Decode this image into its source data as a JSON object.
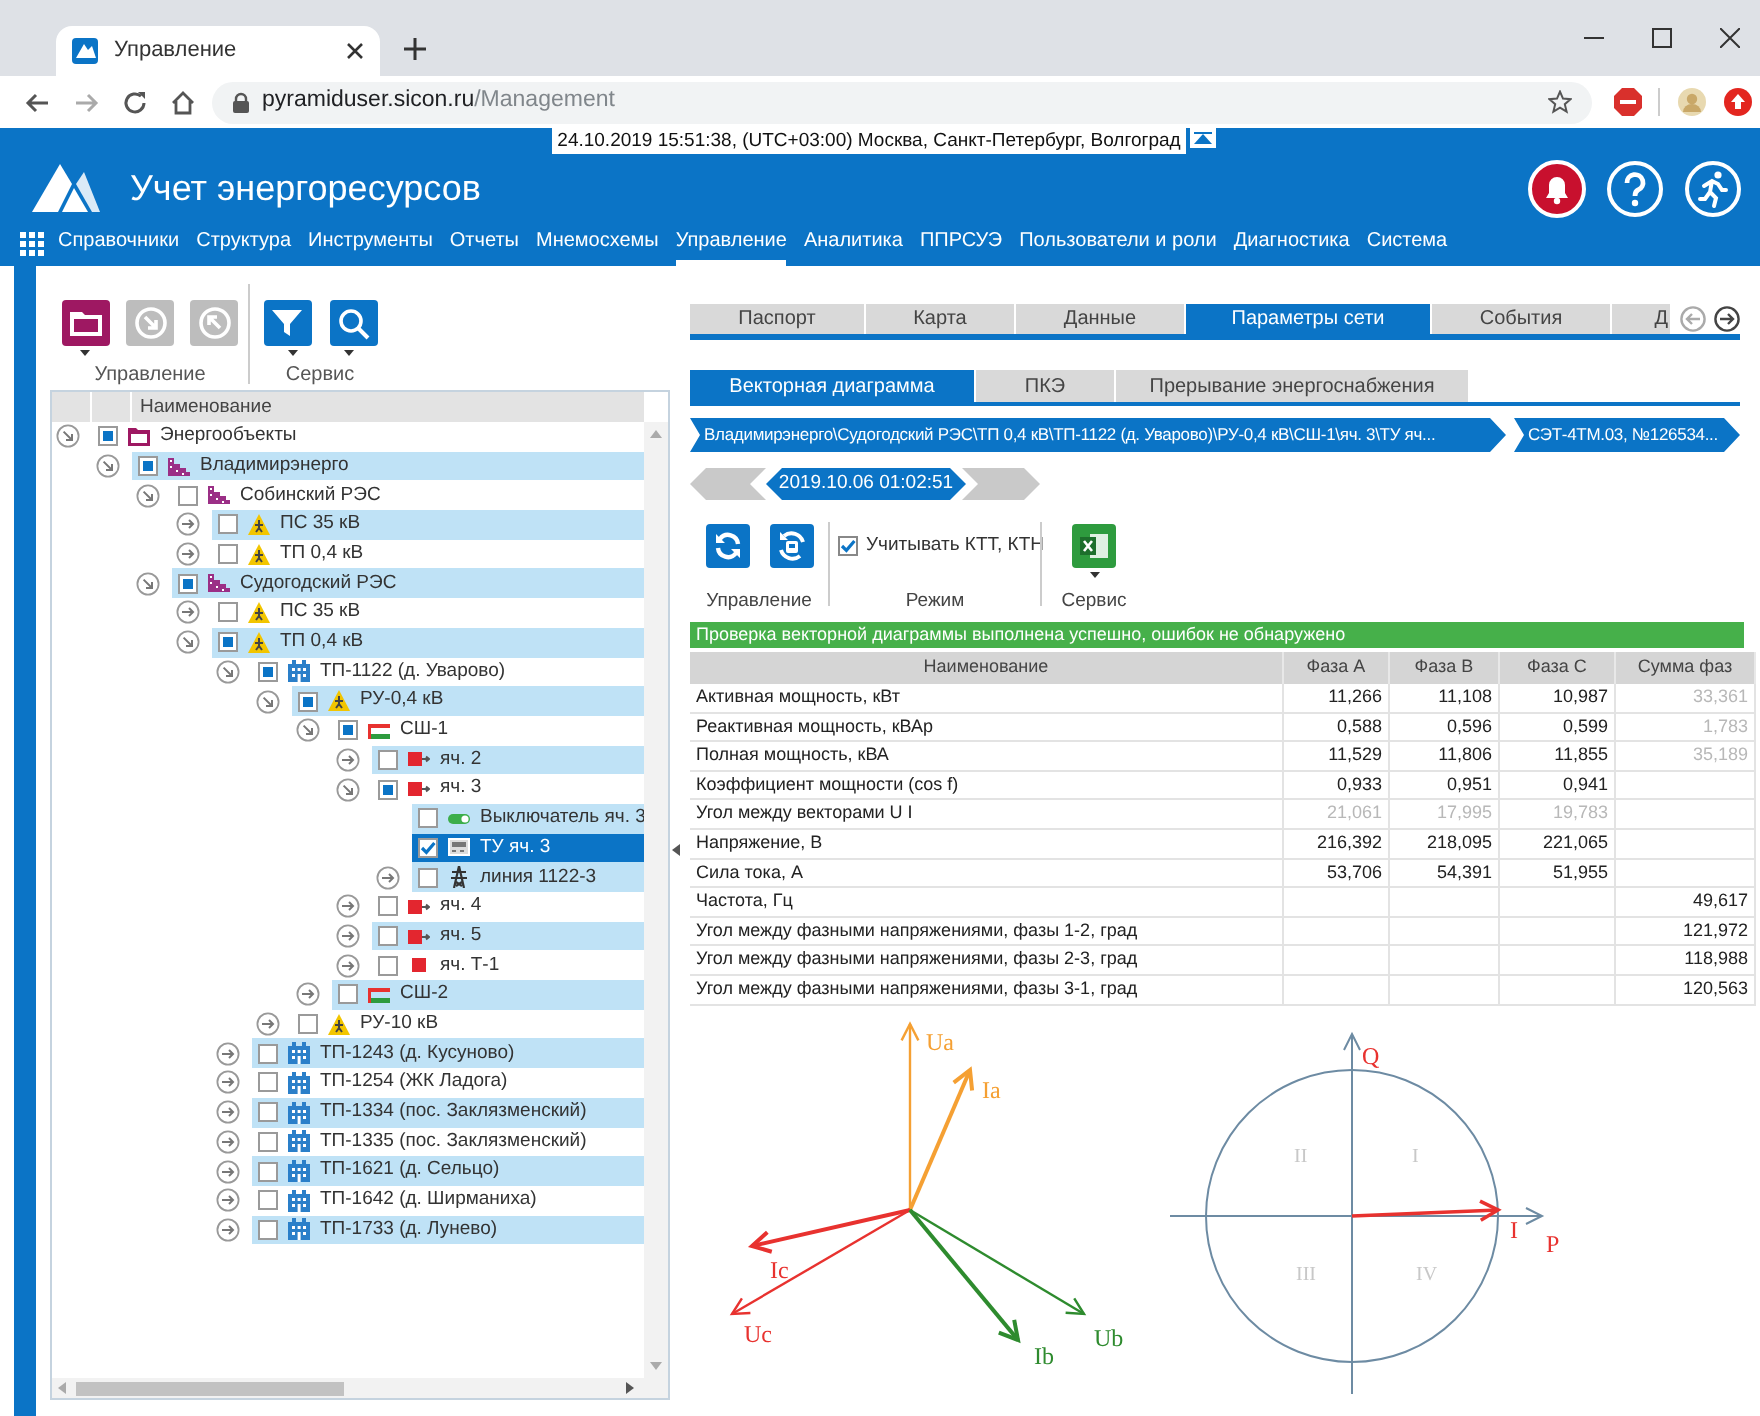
{
  "browser": {
    "tab_title": "Управление",
    "url_host": "pyramiduser.sicon.ru",
    "url_path": "/Management"
  },
  "header": {
    "datetime": "24.10.2019 15:51:38, (UTC+03:00) Москва, Санкт-Петербург, Волгоград",
    "title": "Учет энергоресурсов"
  },
  "nav": [
    {
      "label": "Справочники",
      "selected": false
    },
    {
      "label": "Структура",
      "selected": false
    },
    {
      "label": "Инструменты",
      "selected": false
    },
    {
      "label": "Отчеты",
      "selected": false
    },
    {
      "label": "Мнемосхемы",
      "selected": false
    },
    {
      "label": "Управление",
      "selected": true
    },
    {
      "label": "Аналитика",
      "selected": false
    },
    {
      "label": "ППРСУЭ",
      "selected": false
    },
    {
      "label": "Пользователи и роли",
      "selected": false
    },
    {
      "label": "Диагностика",
      "selected": false
    },
    {
      "label": "Система",
      "selected": false
    }
  ],
  "left_toolbar": {
    "group_labels": [
      "Управление",
      "Сервис"
    ]
  },
  "tree": {
    "column": "Наименование",
    "nodes": [
      {
        "label": "Энергообъекты",
        "kind": "folder",
        "expanded": true,
        "checked": false,
        "partial": true,
        "selected": false,
        "children": [
          {
            "label": "Владимирэнерго",
            "kind": "company",
            "expanded": true,
            "checked": false,
            "partial": true,
            "selected": false,
            "children": [
              {
                "label": "Собинский РЭС",
                "kind": "company",
                "expanded": true,
                "checked": false,
                "partial": false,
                "selected": false,
                "children": [
                  {
                    "label": "ПС 35 кВ",
                    "kind": "hazard",
                    "expanded": false,
                    "checked": false,
                    "partial": false,
                    "selected": false
                  },
                  {
                    "label": "ТП 0,4 кВ",
                    "kind": "hazard",
                    "expanded": false,
                    "checked": false,
                    "partial": false,
                    "selected": false
                  }
                ]
              },
              {
                "label": "Судогодский РЭС",
                "kind": "company",
                "expanded": true,
                "checked": false,
                "partial": true,
                "selected": false,
                "children": [
                  {
                    "label": "ПС 35 кВ",
                    "kind": "hazard",
                    "expanded": false,
                    "checked": false,
                    "partial": false,
                    "selected": false
                  },
                  {
                    "label": "ТП 0,4 кВ",
                    "kind": "hazard",
                    "expanded": true,
                    "checked": false,
                    "partial": true,
                    "selected": false,
                    "children": [
                      {
                        "label": "ТП-1122 (д. Уварово)",
                        "kind": "substation",
                        "expanded": true,
                        "checked": false,
                        "partial": true,
                        "selected": false,
                        "children": [
                          {
                            "label": "РУ-0,4 кВ",
                            "kind": "hazard",
                            "expanded": true,
                            "checked": false,
                            "partial": true,
                            "selected": false,
                            "children": [
                              {
                                "label": "СШ-1",
                                "kind": "busbar",
                                "expanded": true,
                                "checked": false,
                                "partial": true,
                                "selected": false,
                                "children": [
                                  {
                                    "label": "яч. 2",
                                    "kind": "cell",
                                    "expanded": false,
                                    "checked": false,
                                    "partial": false,
                                    "selected": false
                                  },
                                  {
                                    "label": "яч. 3",
                                    "kind": "cell",
                                    "expanded": true,
                                    "checked": false,
                                    "partial": true,
                                    "selected": false,
                                    "children": [
                                      {
                                        "label": "Выключатель яч. 3",
                                        "kind": "switch",
                                        "checked": false,
                                        "partial": false,
                                        "selected": false
                                      },
                                      {
                                        "label": "ТУ яч. 3",
                                        "kind": "meter",
                                        "checked": true,
                                        "partial": false,
                                        "selected": true
                                      },
                                      {
                                        "label": "линия 1122-3",
                                        "kind": "pylon",
                                        "expanded": false,
                                        "checked": false,
                                        "partial": false,
                                        "selected": false
                                      }
                                    ]
                                  },
                                  {
                                    "label": "яч. 4",
                                    "kind": "cell",
                                    "expanded": false,
                                    "checked": false,
                                    "partial": false,
                                    "selected": false
                                  },
                                  {
                                    "label": "яч. 5",
                                    "kind": "cell",
                                    "expanded": false,
                                    "checked": false,
                                    "partial": false,
                                    "selected": false
                                  },
                                  {
                                    "label": "яч. Т-1",
                                    "kind": "square",
                                    "expanded": false,
                                    "checked": false,
                                    "partial": false,
                                    "selected": false
                                  }
                                ]
                              },
                              {
                                "label": "СШ-2",
                                "kind": "busbar",
                                "expanded": false,
                                "checked": false,
                                "partial": false,
                                "selected": false
                              }
                            ]
                          },
                          {
                            "label": "РУ-10 кВ",
                            "kind": "hazard",
                            "expanded": false,
                            "checked": false,
                            "partial": false,
                            "selected": false
                          }
                        ]
                      },
                      {
                        "label": "ТП-1243 (д. Кусуново)",
                        "kind": "substation",
                        "expanded": false,
                        "checked": false,
                        "partial": false,
                        "selected": false
                      },
                      {
                        "label": "ТП-1254 (ЖК Ладога)",
                        "kind": "substation",
                        "expanded": false,
                        "checked": false,
                        "partial": false,
                        "selected": false
                      },
                      {
                        "label": "ТП-1334 (пос. Заклязменский)",
                        "kind": "substation",
                        "expanded": false,
                        "checked": false,
                        "partial": false,
                        "selected": false
                      },
                      {
                        "label": "ТП-1335 (пос. Заклязменский)",
                        "kind": "substation",
                        "expanded": false,
                        "checked": false,
                        "partial": false,
                        "selected": false
                      },
                      {
                        "label": "ТП-1621 (д. Сельцо)",
                        "kind": "substation",
                        "expanded": false,
                        "checked": false,
                        "partial": false,
                        "selected": false
                      },
                      {
                        "label": "ТП-1642 (д. Ширманиха)",
                        "kind": "substation",
                        "expanded": false,
                        "checked": false,
                        "partial": false,
                        "selected": false
                      },
                      {
                        "label": "ТП-1733 (д. Лунево)",
                        "kind": "substation",
                        "expanded": false,
                        "checked": false,
                        "partial": false,
                        "selected": false
                      }
                    ]
                  }
                ]
              }
            ]
          }
        ]
      }
    ]
  },
  "tabs": [
    {
      "label": "Паспорт",
      "selected": false
    },
    {
      "label": "Карта",
      "selected": false
    },
    {
      "label": "Данные",
      "selected": false
    },
    {
      "label": "Параметры сети",
      "selected": true
    },
    {
      "label": "События",
      "selected": false
    },
    {
      "label": "Д",
      "selected": false
    }
  ],
  "subtabs": [
    {
      "label": "Векторная диаграмма",
      "selected": true
    },
    {
      "label": "ПКЭ",
      "selected": false
    },
    {
      "label": "Прерывание энергоснабжения",
      "selected": false
    }
  ],
  "breadcrumb": [
    "Владимирэнерго\\Судогодский РЭС\\ТП 0,4 кВ\\ТП-1122 (д. Уварово)\\РУ-0,4 кВ\\СШ-1\\яч. 3\\ТУ яч...",
    "СЭТ-4ТМ.03, №126534..."
  ],
  "date": "2019.10.06 01:02:51",
  "toolbar": {
    "group_labels": [
      "Управление",
      "Режим",
      "Сервис"
    ],
    "option": {
      "label": "Учитывать КТТ, КТН",
      "checked": true
    }
  },
  "status": "Проверка векторной диаграммы выполнена успешно, ошибок не обнаружено",
  "table": {
    "columns": [
      "Наименование",
      "Фаза A",
      "Фаза B",
      "Фаза C",
      "Сумма фаз"
    ],
    "rows": [
      {
        "cells": [
          {
            "text": "Активная мощность, кВт",
            "dimmed": false
          },
          {
            "text": "11,266",
            "dimmed": false
          },
          {
            "text": "11,108",
            "dimmed": false
          },
          {
            "text": "10,987",
            "dimmed": false
          },
          {
            "text": "33,361",
            "dimmed": true
          }
        ]
      },
      {
        "cells": [
          {
            "text": "Реактивная мощность, кВАр",
            "dimmed": false
          },
          {
            "text": "0,588",
            "dimmed": false
          },
          {
            "text": "0,596",
            "dimmed": false
          },
          {
            "text": "0,599",
            "dimmed": false
          },
          {
            "text": "1,783",
            "dimmed": true
          }
        ]
      },
      {
        "cells": [
          {
            "text": "Полная мощность, кВА",
            "dimmed": false
          },
          {
            "text": "11,529",
            "dimmed": false
          },
          {
            "text": "11,806",
            "dimmed": false
          },
          {
            "text": "11,855",
            "dimmed": false
          },
          {
            "text": "35,189",
            "dimmed": true
          }
        ]
      },
      {
        "cells": [
          {
            "text": "Коэффициент мощности (cos f)",
            "dimmed": false
          },
          {
            "text": "0,933",
            "dimmed": false
          },
          {
            "text": "0,951",
            "dimmed": false
          },
          {
            "text": "0,941",
            "dimmed": false
          },
          ""
        ]
      },
      {
        "cells": [
          {
            "text": "Угол между векторами U I",
            "dimmed": false
          },
          {
            "text": "21,061",
            "dimmed": true
          },
          {
            "text": "17,995",
            "dimmed": true
          },
          {
            "text": "19,783",
            "dimmed": true
          },
          ""
        ]
      },
      {
        "cells": [
          {
            "text": "Напряжение, В",
            "dimmed": false
          },
          {
            "text": "216,392",
            "dimmed": false
          },
          {
            "text": "218,095",
            "dimmed": false
          },
          {
            "text": "221,065",
            "dimmed": false
          },
          ""
        ]
      },
      {
        "cells": [
          {
            "text": "Сила тока, А",
            "dimmed": false
          },
          {
            "text": "53,706",
            "dimmed": false
          },
          {
            "text": "54,391",
            "dimmed": false
          },
          {
            "text": "51,955",
            "dimmed": false
          },
          ""
        ]
      },
      {
        "cells": [
          {
            "text": "Частота, Гц",
            "dimmed": false
          },
          "",
          "",
          "",
          {
            "text": "49,617",
            "dimmed": false
          }
        ]
      },
      {
        "cells": [
          {
            "text": "Угол между фазными напряжениями, фазы 1-2, град",
            "dimmed": false
          },
          "",
          "",
          "",
          {
            "text": "121,972",
            "dimmed": false
          }
        ]
      },
      {
        "cells": [
          {
            "text": "Угол между фазными напряжениями, фазы 2-3, град",
            "dimmed": false
          },
          "",
          "",
          "",
          {
            "text": "118,988",
            "dimmed": false
          }
        ]
      },
      {
        "cells": [
          {
            "text": "Угол между фазными напряжениями, фазы 3-1, град",
            "dimmed": false
          },
          "",
          "",
          "",
          {
            "text": "120,563",
            "dimmed": false
          }
        ]
      }
    ]
  },
  "vector_diagram": {
    "vectors": [
      {
        "label": "Ua",
        "kind": "voltage",
        "color": "#f5a033"
      },
      {
        "label": "Ia",
        "kind": "current",
        "color": "#f5a033"
      },
      {
        "label": "Ic",
        "kind": "current",
        "color": "#e8322f"
      },
      {
        "label": "Uc",
        "kind": "voltage",
        "color": "#e8322f"
      },
      {
        "label": "Ib",
        "kind": "current",
        "color": "#2e8b2e"
      },
      {
        "label": "Ub",
        "kind": "voltage",
        "color": "#2e8b2e"
      }
    ]
  },
  "power_circle": {
    "axes": [
      "Q",
      "P"
    ],
    "quadrants": [
      "II",
      "I",
      "III",
      "IV"
    ],
    "vector": "I"
  }
}
